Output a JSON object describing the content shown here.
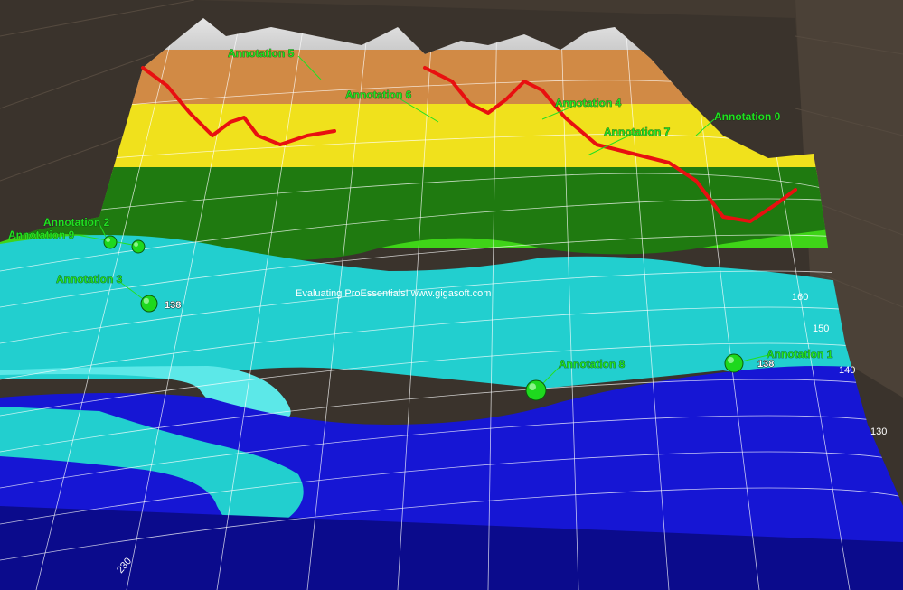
{
  "watermark": "Evaluating ProEssentials! www.gigasoft.com",
  "chart_data": {
    "type": "surface3d",
    "title": "",
    "contour_colors": [
      "#0b0b8c",
      "#1616d4",
      "#22cfcf",
      "#b5f02a",
      "#1f7a10",
      "#3fd418",
      "#f0e11c",
      "#d18a45",
      "#c8c8c8"
    ],
    "colors": {
      "grid": "#ffffff",
      "line": "#e81010",
      "annotation": "#22e022",
      "marker": "#1ed81e"
    },
    "y_ticks": [
      "160",
      "150",
      "140",
      "130"
    ],
    "x_ticks": [
      "230"
    ],
    "annotations": [
      {
        "label": "Annotation 0"
      },
      {
        "label": "Annotation 1",
        "value": "138"
      },
      {
        "label": "Annotation 2"
      },
      {
        "label": "Annotation 3",
        "value": "138"
      },
      {
        "label": "Annotation 4"
      },
      {
        "label": "Annotation 5"
      },
      {
        "label": "Annotation 6"
      },
      {
        "label": "Annotation 7"
      },
      {
        "label": "Annotation 8"
      },
      {
        "label": "Annotation 9"
      }
    ]
  }
}
